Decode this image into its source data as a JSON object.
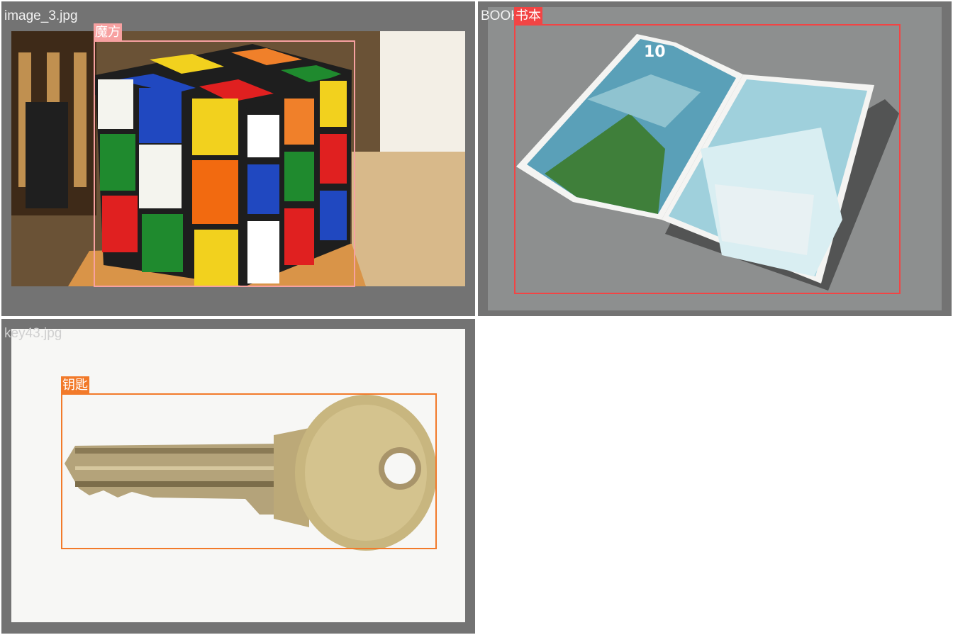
{
  "tiles": [
    {
      "filename": "image_3.jpg",
      "label": "魔方",
      "box_color": "#f7a1a1"
    },
    {
      "filename": "BOOK.jpg",
      "label": "书本",
      "box_color": "#f24444"
    },
    {
      "filename": "key43.jpg",
      "label": "钥匙",
      "box_color": "#f27a2a"
    }
  ]
}
